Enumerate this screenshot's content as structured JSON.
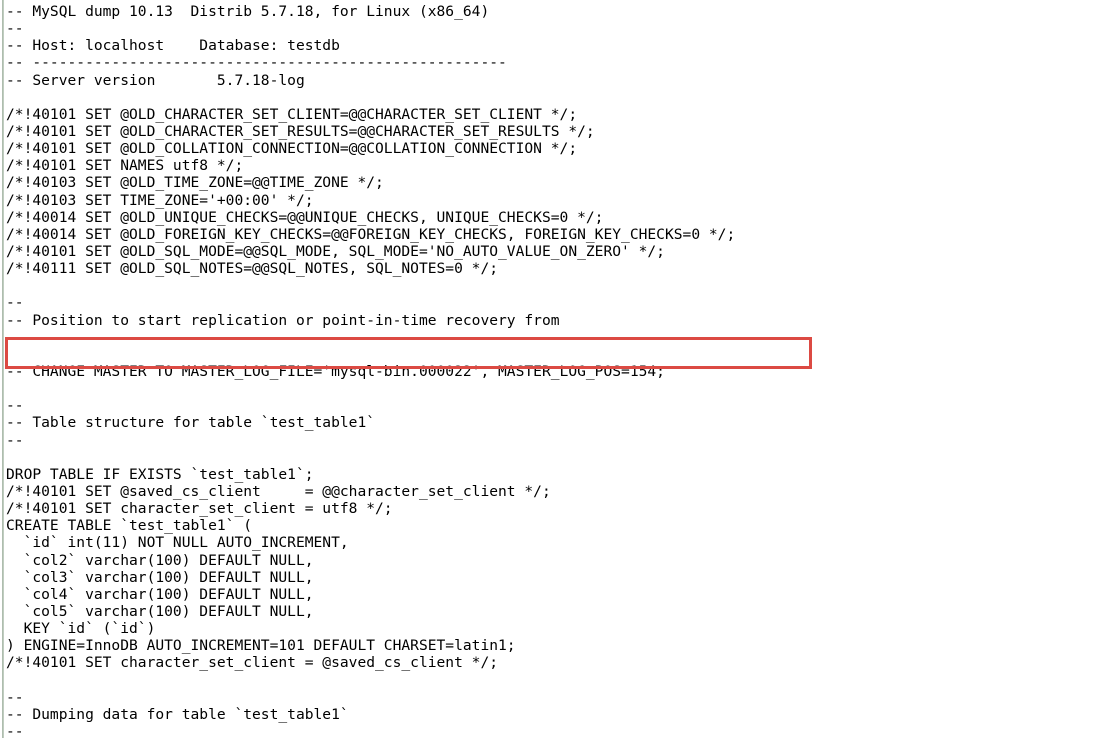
{
  "document": {
    "type": "mysqldump-sql-output",
    "title": "MySQL dump 10.13 Distrib 5.7.18, for Linux (x86_64)",
    "host": "localhost",
    "database": "testdb",
    "server_version": "5.7.18-log",
    "table_name": "test_table1"
  },
  "annotation": {
    "shape": "rectangle",
    "color": "#dc4a43",
    "border_width_px": 3,
    "target_line_index": 20,
    "target_text": "-- CHANGE MASTER TO MASTER_LOG_FILE='mysql-bin.000022', MASTER_LOG_POS=154;"
  },
  "binlog": {
    "master_log_file": "mysql-bin.000022",
    "master_log_pos": "154"
  },
  "table_definition": {
    "name": "test_table1",
    "engine": "InnoDB",
    "auto_increment": "101",
    "default_charset": "latin1",
    "columns": [
      {
        "name": "id",
        "type": "int(11)",
        "attrs": "NOT NULL AUTO_INCREMENT"
      },
      {
        "name": "col2",
        "type": "varchar(100)",
        "attrs": "DEFAULT NULL"
      },
      {
        "name": "col3",
        "type": "varchar(100)",
        "attrs": "DEFAULT NULL"
      },
      {
        "name": "col4",
        "type": "varchar(100)",
        "attrs": "DEFAULT NULL"
      },
      {
        "name": "col5",
        "type": "varchar(100)",
        "attrs": "DEFAULT NULL"
      }
    ],
    "keys": [
      "KEY `id` (`id`)"
    ]
  },
  "lines": [
    "-- MySQL dump 10.13  Distrib 5.7.18, for Linux (x86_64)",
    "--",
    "-- Host: localhost    Database: testdb",
    "-- ------------------------------------------------------",
    "-- Server version       5.7.18-log",
    "",
    "/*!40101 SET @OLD_CHARACTER_SET_CLIENT=@@CHARACTER_SET_CLIENT */;",
    "/*!40101 SET @OLD_CHARACTER_SET_RESULTS=@@CHARACTER_SET_RESULTS */;",
    "/*!40101 SET @OLD_COLLATION_CONNECTION=@@COLLATION_CONNECTION */;",
    "/*!40101 SET NAMES utf8 */;",
    "/*!40103 SET @OLD_TIME_ZONE=@@TIME_ZONE */;",
    "/*!40103 SET TIME_ZONE='+00:00' */;",
    "/*!40014 SET @OLD_UNIQUE_CHECKS=@@UNIQUE_CHECKS, UNIQUE_CHECKS=0 */;",
    "/*!40014 SET @OLD_FOREIGN_KEY_CHECKS=@@FOREIGN_KEY_CHECKS, FOREIGN_KEY_CHECKS=0 */;",
    "/*!40101 SET @OLD_SQL_MODE=@@SQL_MODE, SQL_MODE='NO_AUTO_VALUE_ON_ZERO' */;",
    "/*!40111 SET @OLD_SQL_NOTES=@@SQL_NOTES, SQL_NOTES=0 */;",
    "",
    "--",
    "-- Position to start replication or point-in-time recovery from",
    "--",
    "",
    "-- CHANGE MASTER TO MASTER_LOG_FILE='mysql-bin.000022', MASTER_LOG_POS=154;",
    "",
    "--",
    "-- Table structure for table `test_table1`",
    "--",
    "",
    "DROP TABLE IF EXISTS `test_table1`;",
    "/*!40101 SET @saved_cs_client     = @@character_set_client */;",
    "/*!40101 SET character_set_client = utf8 */;",
    "CREATE TABLE `test_table1` (",
    "  `id` int(11) NOT NULL AUTO_INCREMENT,",
    "  `col2` varchar(100) DEFAULT NULL,",
    "  `col3` varchar(100) DEFAULT NULL,",
    "  `col4` varchar(100) DEFAULT NULL,",
    "  `col5` varchar(100) DEFAULT NULL,",
    "  KEY `id` (`id`)",
    ") ENGINE=InnoDB AUTO_INCREMENT=101 DEFAULT CHARSET=latin1;",
    "/*!40101 SET character_set_client = @saved_cs_client */;",
    "",
    "--",
    "-- Dumping data for table `test_table1`",
    "--"
  ]
}
